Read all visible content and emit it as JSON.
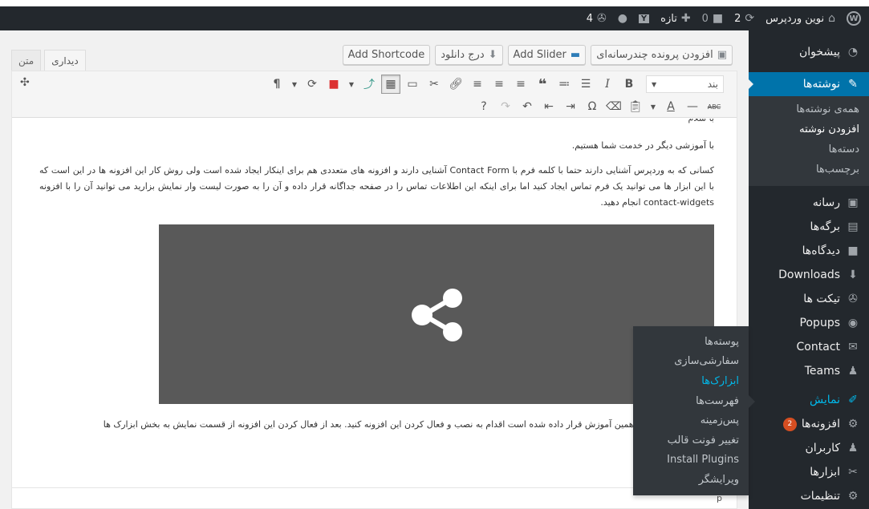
{
  "adminbar": {
    "site_name": "نوین وردپرس",
    "updates_count": "2",
    "comments_count": "0",
    "new_label": "تازه",
    "extra_count": "4"
  },
  "sidebar": {
    "items": [
      {
        "label": "پیشخوان",
        "icon": "dashboard-icon"
      },
      {
        "label": "نوشته‌ها",
        "icon": "pin-icon"
      },
      {
        "label": "رسانه",
        "icon": "media-icon"
      },
      {
        "label": "برگه‌ها",
        "icon": "pages-icon"
      },
      {
        "label": "دیدگاه‌ها",
        "icon": "comments-icon"
      },
      {
        "label": "Downloads",
        "icon": "download-icon"
      },
      {
        "label": "تیکت ها",
        "icon": "ticket-icon"
      },
      {
        "label": "Popups",
        "icon": "popup-icon"
      },
      {
        "label": "Contact",
        "icon": "mail-icon"
      },
      {
        "label": "Teams",
        "icon": "team-icon"
      },
      {
        "label": "نمایش",
        "icon": "appearance-icon"
      },
      {
        "label": "افزونه‌ها",
        "icon": "plugin-icon",
        "badge": "2"
      },
      {
        "label": "کاربران",
        "icon": "users-icon"
      },
      {
        "label": "ابزارها",
        "icon": "tools-icon"
      },
      {
        "label": "تنظیمات",
        "icon": "settings-icon"
      }
    ],
    "posts_submenu": [
      "همه‌ی نوشته‌ها",
      "افزودن نوشته",
      "دسته‌ها",
      "برچسب‌ها"
    ]
  },
  "flyout": {
    "items": [
      "پوسته‌ها",
      "سفارشی‌سازی",
      "ابزارک‌ها",
      "فهرست‌ها",
      "پس‌زمینه",
      "تغییر فونت قالب",
      "Install Plugins",
      "ویرایشگر"
    ]
  },
  "editor": {
    "buttons": {
      "gallery": "افزودن پرونده چندرسانه‌ای",
      "slider": "Add Slider",
      "download": "درج دانلود",
      "shortcode": "Add Shortcode"
    },
    "tabs": {
      "visual": "دیداری",
      "text": "متن"
    },
    "format_select": "بند",
    "content": {
      "cut_line": "با سلام",
      "line1": "با آموزشی دیگر در خدمت شما هستیم.",
      "para2": "کسانی که به وردپرس آشنایی دارند حتما با کلمه فرم با Contact Form آشنایی دارند و افزونه های متعددی هم برای اینکار ایجاد شده است ولی روش کار این افزونه ها در این است که با این ابزار ها می توانید یک فرم تماس ایجاد کنید اما برای اینکه این اطلاعات تماس را  در صفحه جداگانه قرار داده و آن را به صورت لیست وار نمایش بزارید می توانید آن را با افزونه contact-widgets انجام دهید.",
      "para3": "ک دانلود آن در انتهای همین آموزش قرار داده شده است اقدام به نصب و فعال کردن این افزونه کنید. بعد از فعال کردن این افزونه از قسمت نمایش به بخش ابزارک ها"
    },
    "status_path": "p"
  }
}
